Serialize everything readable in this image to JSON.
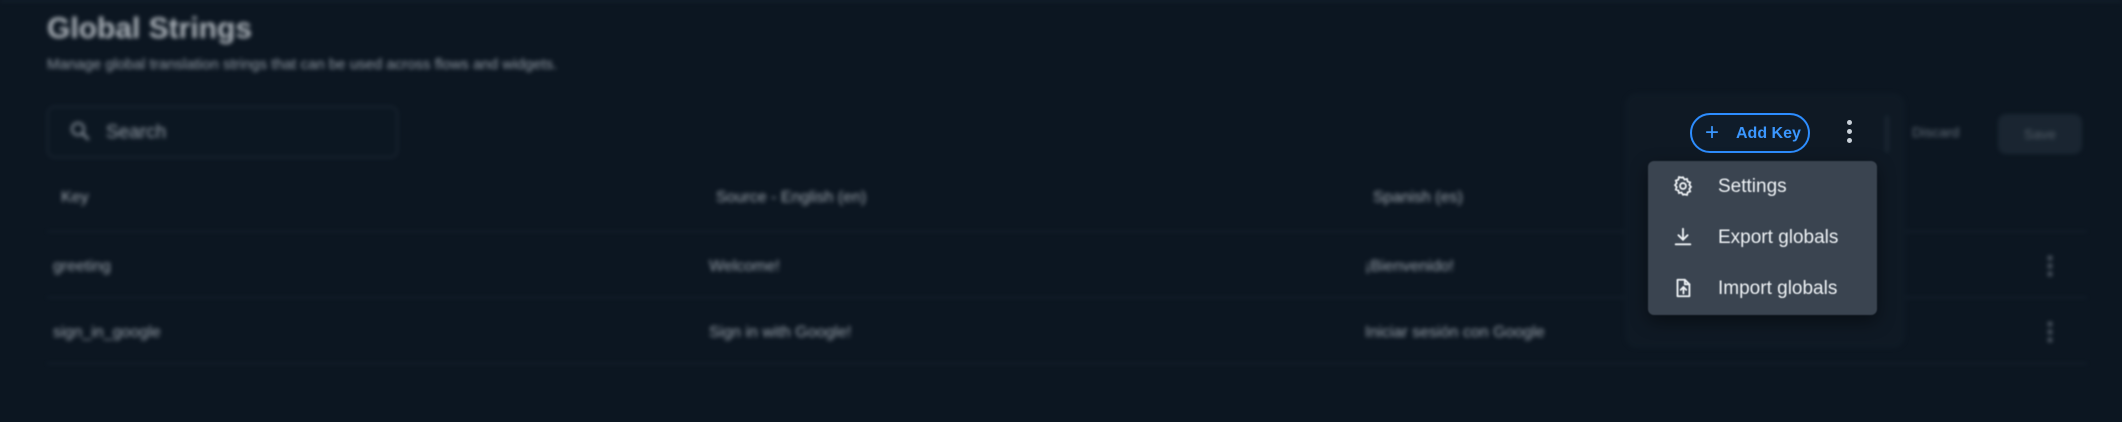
{
  "page": {
    "title": "Global Strings",
    "subtitle": "Manage global translation strings that can be used across flows and widgets."
  },
  "search": {
    "placeholder": "Search",
    "value": ""
  },
  "toolbar": {
    "add_key_label": "Add Key",
    "discard_label": "Discard",
    "save_label": "Save"
  },
  "table": {
    "columns": [
      "Key",
      "Source - English (en)",
      "Spanish (es)"
    ],
    "rows": [
      {
        "key": "greeting",
        "source": "Welcome!",
        "spanish": "¡Bienvenido!"
      },
      {
        "key": "sign_in_google",
        "source": "Sign in with Google!",
        "spanish": "Iniciar sesión con Google"
      }
    ]
  },
  "menu": {
    "items": [
      {
        "label": "Settings",
        "icon": "gear-icon"
      },
      {
        "label": "Export globals",
        "icon": "download-icon"
      },
      {
        "label": "Import globals",
        "icon": "file-upload-icon"
      }
    ]
  },
  "colors": {
    "background": "#0c1621",
    "accent": "#2d8dff",
    "menu_background": "#3a4450"
  }
}
